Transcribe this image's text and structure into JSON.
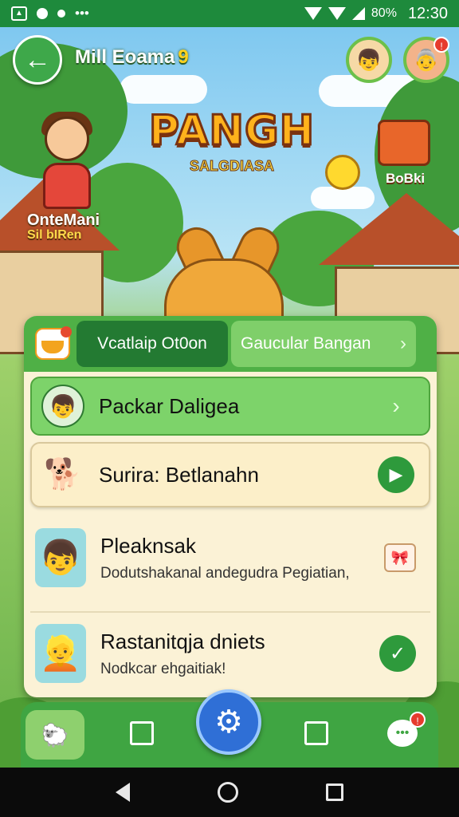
{
  "status_bar": {
    "left_icons": [
      "image-icon",
      "chat-icon",
      "dot-icon",
      "more-icon"
    ],
    "battery": "80%",
    "time": "12:30"
  },
  "header": {
    "back_icon": "←",
    "title": "Mill Eoama",
    "badge_glyph": "9",
    "avatar1_glyph": "👦",
    "avatar2_glyph": "👵",
    "avatar2_notification": "!"
  },
  "scene": {
    "logo_title": "PANGH",
    "logo_sub": "SALGDIASA",
    "girl_name": "OnteMani",
    "girl_subname": "Sil  bIRen",
    "chest_label": "BoBki"
  },
  "panel": {
    "tabs": [
      {
        "label": "Vcatlaip Ot0on"
      },
      {
        "label": "Gaucular Bangan",
        "chevron": "›"
      }
    ],
    "rows": [
      {
        "title": "Packar Daligea",
        "avatar": "👦",
        "action": "›"
      },
      {
        "title": "Surira: Betlanahn",
        "avatar": "🐕",
        "action": "▶"
      },
      {
        "title": "Pleaknsak",
        "subtitle": "Dodutshakanal andegudra Pegiatian,",
        "avatar": "👦",
        "action": "🎀"
      },
      {
        "title": "Rastanitqja dniets",
        "subtitle": "Nodkcar ehgaitiak!",
        "avatar": "👱",
        "action": "✓"
      }
    ]
  },
  "bottom_nav": {
    "home_glyph": "🐑",
    "settings_glyph": "⚙",
    "chat_glyph": "•••",
    "chat_notification": "!"
  }
}
